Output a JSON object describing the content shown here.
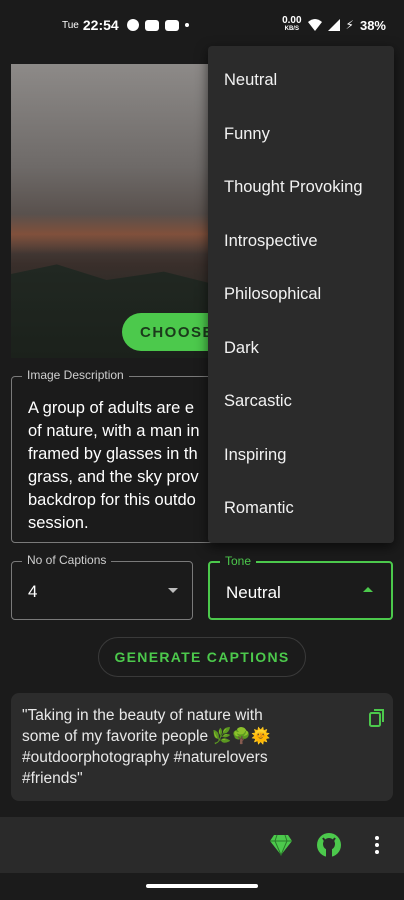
{
  "status_bar": {
    "day": "Tue",
    "time": "22:54",
    "net_speed": "0.00",
    "net_unit": "KB/S",
    "battery": "38%"
  },
  "image_panel": {
    "choose_label": "CHOOSE"
  },
  "image_description": {
    "label": "Image Description",
    "lines": [
      "A group of adults are e",
      "of nature, with a man in",
      "framed by glasses in th",
      "grass, and the sky prov",
      "backdrop for this outdo",
      "session."
    ]
  },
  "num_captions": {
    "label": "No of Captions",
    "value": "4"
  },
  "tone": {
    "label": "Tone",
    "value": "Neutral",
    "options": [
      "Neutral",
      "Funny",
      "Thought Provoking",
      "Introspective",
      "Philosophical",
      "Dark",
      "Sarcastic",
      "Inspiring",
      "Romantic"
    ]
  },
  "generate_label": "GENERATE CAPTIONS",
  "caption": {
    "lines": [
      "\"Taking in the beauty of nature with",
      "some of my favorite people 🌿🌳🌞",
      "#outdoorphotography #naturelovers",
      "#friends\""
    ]
  },
  "bottom_bar": {
    "icons": [
      "gem-icon",
      "github-icon",
      "more-vert-icon"
    ]
  },
  "colors": {
    "accent": "#4cc94c",
    "background": "#1b1b1b",
    "surface": "#2b2b2b"
  }
}
